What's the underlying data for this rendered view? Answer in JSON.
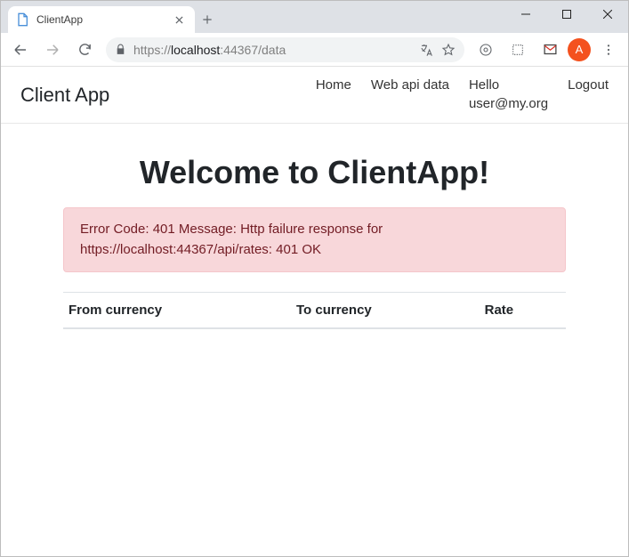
{
  "browser": {
    "tab_title": "ClientApp",
    "url_prefix": "https://",
    "url_host": "localhost",
    "url_path": ":44367/data",
    "avatar_letter": "A"
  },
  "nav": {
    "brand": "Client App",
    "home": "Home",
    "webapi": "Web api data",
    "greeting_line1": "Hello",
    "greeting_line2": "user@my.org",
    "logout": "Logout"
  },
  "page": {
    "headline": "Welcome to ClientApp!",
    "error_message": "Error Code: 401 Message: Http failure response for https://localhost:44367/api/rates: 401 OK"
  },
  "table": {
    "col_from": "From currency",
    "col_to": "To currency",
    "col_rate": "Rate"
  }
}
